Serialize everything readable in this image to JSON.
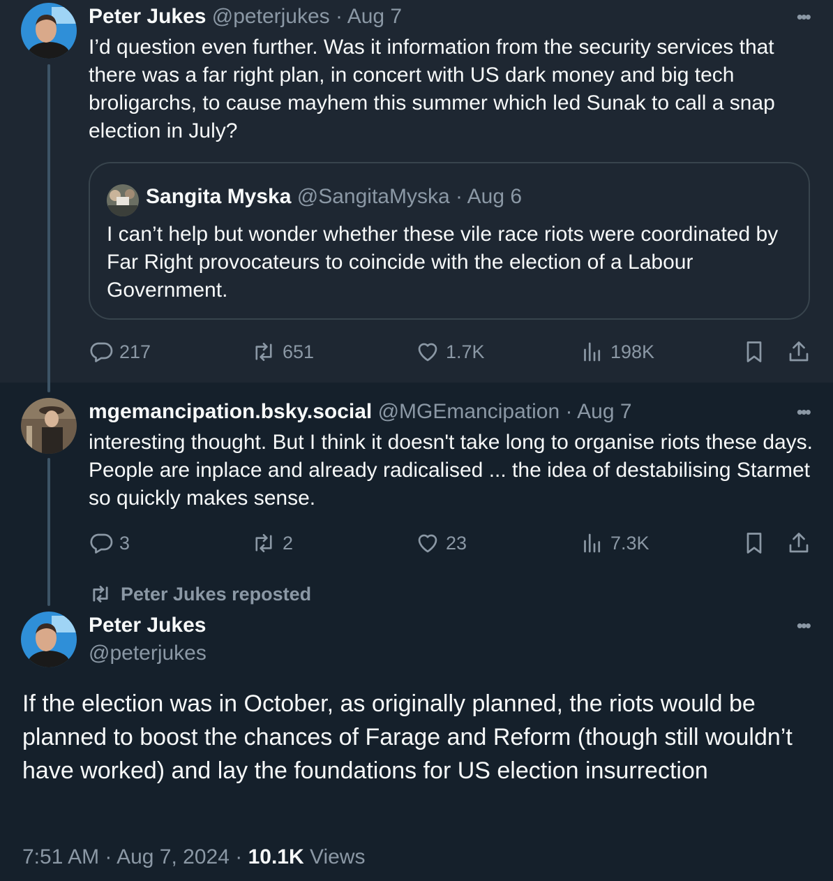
{
  "tweet1": {
    "name": "Peter Jukes",
    "handle": "@peterjukes",
    "dot": " · ",
    "date": "Aug 7",
    "more": "•••",
    "text": "I’d question even further. Was it information from the security services that there was a far right plan, in concert with US dark money and big tech broligarchs, to cause mayhem this summer which led Sunak to call a snap election in July?",
    "quote": {
      "name": "Sangita Myska",
      "handle": "@SangitaMyska",
      "dot": " · ",
      "date": "Aug 6",
      "text": "I can’t help but wonder whether these vile race riots were coordinated by Far Right provocateurs to coincide with the election of a Labour Government."
    },
    "stats": {
      "replies": "217",
      "reposts": "651",
      "likes": "1.7K",
      "views": "198K"
    }
  },
  "tweet2": {
    "name": "mgemancipation.bsky.social",
    "handle": "@MGEmancipation",
    "dot": " · ",
    "date": "Aug 7",
    "more": "•••",
    "text": "interesting thought. But I think it doesn't take long to organise riots these days. People are inplace and already radicalised ... the idea of destabilising Starmet so quickly makes sense.",
    "stats": {
      "replies": "3",
      "reposts": "2",
      "likes": "23",
      "views": "7.3K"
    }
  },
  "main_tweet": {
    "reposted_label": "Peter Jukes reposted",
    "name": "Peter Jukes",
    "handle": "@peterjukes",
    "more": "•••",
    "text": "If the election was in October, as originally planned, the riots would be planned to boost the chances of Farage and Reform (though still wouldn’t have worked) and lay the foundations for US election insurrection",
    "time": "7:51 AM",
    "date": "Aug 7, 2024",
    "dot": " · ",
    "views_count": "10.1K",
    "views_label": " Views"
  },
  "icons": {
    "reply": "reply-icon",
    "repost": "repost-icon",
    "like": "heart-icon",
    "views": "analytics-icon",
    "bookmark": "bookmark-icon",
    "share": "share-icon",
    "more": "more-icon"
  },
  "colors": {
    "background": "#15202b",
    "highlight_background": "#1e2732",
    "text": "#f7f9f9",
    "muted": "#8b98a5",
    "border": "#38444d"
  }
}
